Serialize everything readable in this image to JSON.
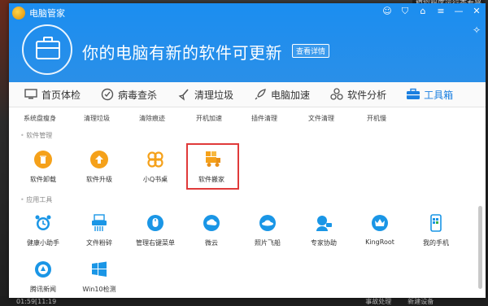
{
  "background": {
    "top_right_text": "模拟程序运行查看器",
    "taskbar": [
      "01:59[11:19",
      "事故处理",
      "新建设备"
    ]
  },
  "window": {
    "title": "电脑管家",
    "headline": "你的电脑有新的软件可更新",
    "detail_button": "查看详情"
  },
  "tabs": [
    {
      "label": "首页体检",
      "icon": "monitor-icon"
    },
    {
      "label": "病毒查杀",
      "icon": "shield-icon"
    },
    {
      "label": "清理垃圾",
      "icon": "broom-icon"
    },
    {
      "label": "电脑加速",
      "icon": "rocket-icon"
    },
    {
      "label": "软件分析",
      "icon": "cluster-icon"
    },
    {
      "label": "工具箱",
      "icon": "toolbox-icon",
      "active": true
    }
  ],
  "top_row": [
    "系统盘瘦身",
    "清理垃圾",
    "清除痕迹",
    "开机加速",
    "插件清理",
    "文件清理",
    "开机慢"
  ],
  "sections": {
    "software": "软件管理",
    "apps": "应用工具"
  },
  "software_items": [
    {
      "label": "软件卸载",
      "icon": "trash-icon",
      "color": "#f5a11a"
    },
    {
      "label": "软件升级",
      "icon": "upload-icon",
      "color": "#f5a11a"
    },
    {
      "label": "小Q书桌",
      "icon": "clover-icon",
      "color": "#f5a11a"
    },
    {
      "label": "软件搬家",
      "icon": "truck-icon",
      "color": "#f5a11a"
    }
  ],
  "app_items": [
    {
      "label": "健康小助手",
      "icon": "alarm-icon"
    },
    {
      "label": "文件粉碎",
      "icon": "shredder-icon"
    },
    {
      "label": "管理右键菜单",
      "icon": "mouse-icon"
    },
    {
      "label": "微云",
      "icon": "cloud-icon"
    },
    {
      "label": "照片飞船",
      "icon": "ufo-icon"
    },
    {
      "label": "专家协助",
      "icon": "expert-icon"
    },
    {
      "label": "KingRoot",
      "icon": "crown-icon"
    },
    {
      "label": "我的手机",
      "icon": "phone-icon"
    }
  ],
  "app_items_row2": [
    {
      "label": "腾讯新闻",
      "icon": "news-icon"
    },
    {
      "label": "Win10检测",
      "icon": "windows-icon"
    }
  ],
  "colors": {
    "header": "#1b8ef0",
    "active_tab": "#1a7fe0",
    "tool_blue": "#1a96e6",
    "highlight": "#e03a3a"
  }
}
